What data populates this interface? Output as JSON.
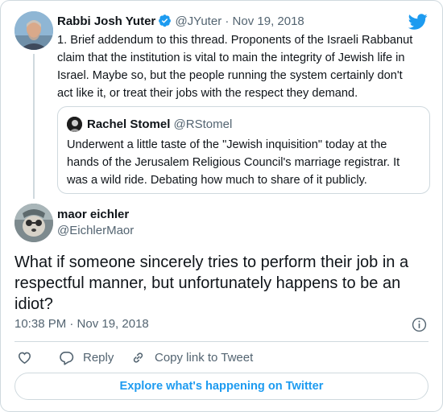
{
  "brand": {
    "logo_icon": "twitter-bird-icon",
    "color": "#1d9bf0"
  },
  "parent_tweet": {
    "author_name": "Rabbi Josh Yuter",
    "verified": true,
    "handle": "@JYuter",
    "separator": " · ",
    "date": "Nov 19, 2018",
    "text": "1. Brief addendum to this thread. Proponents of the Israeli Rabbanut claim that the institution is vital to main the integrity of Jewish life in Israel. Maybe so, but the people running the system certainly don't act like it, or treat their jobs with the respect they demand."
  },
  "quoted_tweet": {
    "author_name": "Rachel Stomel",
    "handle": "@RStomel",
    "text": "Underwent a little taste of the \"Jewish inquisition\" today at the hands of the Jerusalem Religious Council's marriage registrar. It was a wild ride. Debating how much to share of it publicly."
  },
  "main_tweet": {
    "author_name": "maor eichler",
    "handle": "@EichlerMaor",
    "text": "What if someone sincerely tries to perform their job in a respectful manner, but unfortunately happens to be an idiot?",
    "timestamp": "10:38 PM · Nov 19, 2018"
  },
  "actions": {
    "like_icon": "heart-icon",
    "reply_label": "Reply",
    "copy_link_label": "Copy link to Tweet"
  },
  "explore_label": "Explore what's happening on Twitter"
}
